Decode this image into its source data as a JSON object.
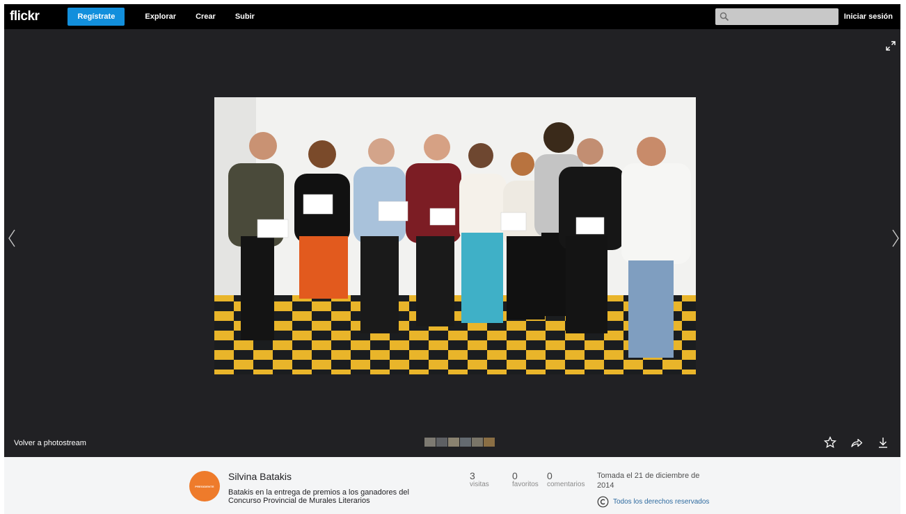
{
  "header": {
    "logo": "flickr",
    "signup_label": "Regístrate",
    "nav": [
      "Explorar",
      "Crear",
      "Subir"
    ],
    "search_placeholder": "",
    "signin_label": "Iniciar sesión"
  },
  "viewer": {
    "back_label": "Volver a photostream",
    "thumbnail_count": 6,
    "icons": [
      "expand-icon",
      "prev-arrow-icon",
      "next-arrow-icon",
      "star-icon",
      "share-icon",
      "download-icon"
    ]
  },
  "info": {
    "avatar_text": "PRESIDENTE",
    "owner": "Silvina Batakis",
    "description": "Batakis en la entrega de premios a los ganadores del Concurso Provincial de Murales Literarios",
    "stats": {
      "views": {
        "value": "3",
        "label": "visitas"
      },
      "faves": {
        "value": "0",
        "label": "favoritos"
      },
      "comments": {
        "value": "0",
        "label": "comentarios"
      }
    },
    "taken": "Tomada el 21 de diciembre de 2014",
    "rights": "Todos los derechos reservados"
  },
  "colors": {
    "header_bg": "#000000",
    "viewer_bg": "#212124",
    "signup_blue": "#128fdc",
    "avatar_orange": "#ee7b2b",
    "link_blue": "#2d6a9f"
  }
}
